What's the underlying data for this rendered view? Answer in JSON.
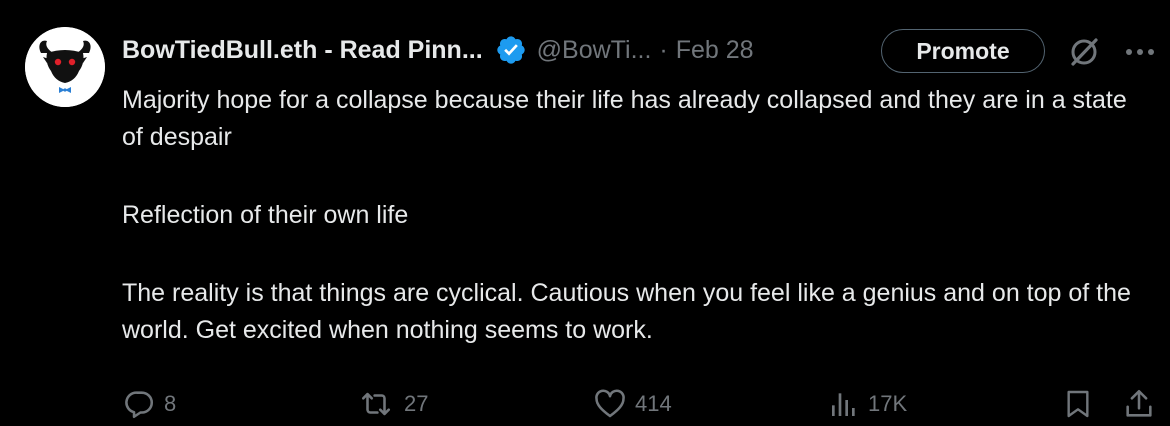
{
  "author": {
    "display_name": "BowTiedBull.eth - Read Pinn...",
    "handle": "@BowTi...",
    "separator": "·",
    "date": "Feb 28",
    "verified": true,
    "verified_color": "#1d9bf0"
  },
  "buttons": {
    "promote_label": "Promote"
  },
  "icons": {
    "grok": "grok-icon",
    "more": "more-icon",
    "reply": "reply-icon",
    "repost": "repost-icon",
    "like": "like-icon",
    "views": "views-icon",
    "bookmark": "bookmark-icon",
    "share": "share-icon"
  },
  "tweet": {
    "paragraphs": [
      "Majority hope for a collapse because their life has already collapsed and they are in a state of despair",
      "Reflection of their own life",
      "The reality is that things are cyclical. Cautious when you feel like a genius and on top of the world. Get excited when nothing seems to work."
    ]
  },
  "stats": {
    "replies": "8",
    "reposts": "27",
    "likes": "414",
    "views": "17K"
  },
  "colors": {
    "background": "#000000",
    "text_primary": "#e7e9ea",
    "text_secondary": "#71767b",
    "avatar_eyes": "#e0202a"
  }
}
